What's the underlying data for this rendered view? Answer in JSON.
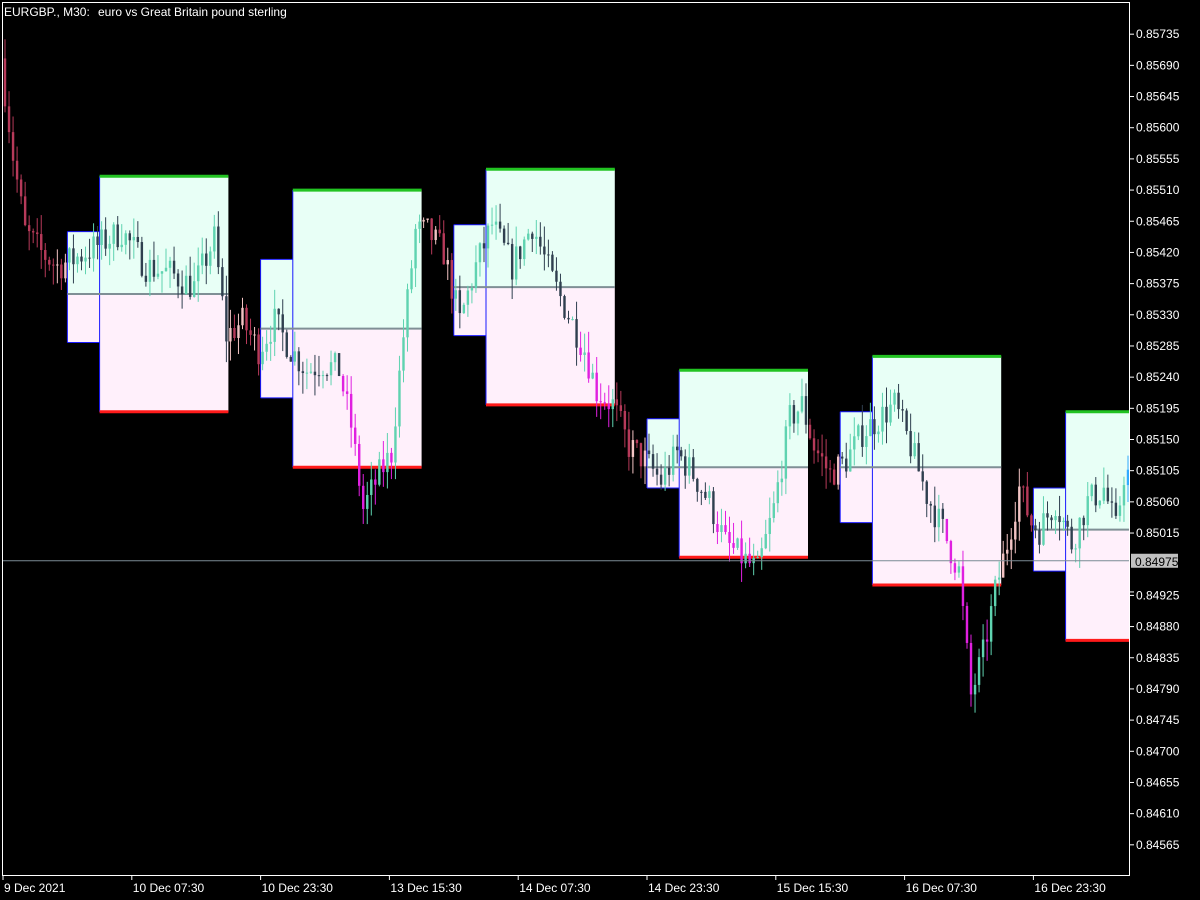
{
  "header": {
    "symbol": "EURGBP., M30:",
    "description": "euro vs Great Britain pound sterling"
  },
  "current_price": {
    "value": 0.84975,
    "label": "0.84975"
  },
  "colors": {
    "background": "#000000",
    "frame": "#ffffff",
    "upper_fill": "#e8fff6",
    "lower_fill": "#fff0fb",
    "high_line": "#22c322",
    "low_line": "#ff1a1a",
    "mid_line": "#7f8f95",
    "edge_line": "#1a1aff",
    "candle_bull_inside": "#5fd3b0",
    "candle_bear_inside": "#2f3f4f",
    "candle_bull_outside": "#f3c4c4",
    "candle_bear_outside": "#b73a5a",
    "candle_bear_strong": "#e020e0",
    "candle_last": "#33aaff",
    "current_price_line": "#7a8a94",
    "price_tag_bg": "#c0c0c0"
  },
  "chart_data": {
    "type": "candlestick",
    "title": "EURGBP., M30: euro vs Great Britain pound sterling",
    "ylim": [
      0.8452,
      0.8578
    ],
    "ytick_values": [
      0.85735,
      0.8569,
      0.85645,
      0.856,
      0.85555,
      0.8551,
      0.85465,
      0.8542,
      0.85375,
      0.8533,
      0.85285,
      0.8524,
      0.85195,
      0.8515,
      0.85105,
      0.8506,
      0.85015,
      0.8493,
      0.84925,
      0.8488,
      0.84835,
      0.8479,
      0.84745,
      0.847,
      0.84655,
      0.8461,
      0.84565
    ],
    "ytick_labels": [
      "0.85735",
      "0.85690",
      "0.85645",
      "0.85600",
      "0.85555",
      "0.85510",
      "0.85465",
      "0.85420",
      "0.85375",
      "0.85330",
      "0.85285",
      "0.85240",
      "0.85195",
      "0.85150",
      "0.85105",
      "0.85060",
      "0.85015",
      "",
      "0.84925",
      "0.84880",
      "0.84835",
      "0.84790",
      "0.84745",
      "0.84700",
      "0.84655",
      "0.84610",
      "0.84565"
    ],
    "xtick_labels": [
      "9 Dec 2021",
      "10 Dec 07:30",
      "10 Dec 23:30",
      "13 Dec 15:30",
      "14 Dec 07:30",
      "14 Dec 23:30",
      "15 Dec 15:30",
      "16 Dec 07:30",
      "16 Dec 23:30"
    ],
    "bar_count": 280,
    "xtick_bars": [
      0,
      32,
      64,
      96,
      128,
      160,
      192,
      224,
      256
    ],
    "grid": false,
    "sessions": [
      {
        "start_bar": 16,
        "end_bar": 56,
        "high": 0.8553,
        "low": 0.8519,
        "mid": 0.8536,
        "steps": [
          {
            "at_bar": 16,
            "top": 0.8545,
            "bottom": 0.8529
          },
          {
            "at_bar": 24,
            "top": 0.8553,
            "bottom": 0.8519
          }
        ]
      },
      {
        "start_bar": 64,
        "end_bar": 104,
        "high": 0.8551,
        "low": 0.8511,
        "mid": 0.8531,
        "steps": [
          {
            "at_bar": 64,
            "top": 0.8541,
            "bottom": 0.8521
          },
          {
            "at_bar": 72,
            "top": 0.8551,
            "bottom": 0.8511
          }
        ]
      },
      {
        "start_bar": 112,
        "end_bar": 152,
        "high": 0.8554,
        "low": 0.852,
        "mid": 0.8537,
        "steps": [
          {
            "at_bar": 112,
            "top": 0.8546,
            "bottom": 0.853
          },
          {
            "at_bar": 120,
            "top": 0.8554,
            "bottom": 0.852
          }
        ]
      },
      {
        "start_bar": 160,
        "end_bar": 200,
        "high": 0.8525,
        "low": 0.8498,
        "mid": 0.8511,
        "steps": [
          {
            "at_bar": 160,
            "top": 0.8518,
            "bottom": 0.8508
          },
          {
            "at_bar": 168,
            "top": 0.8525,
            "bottom": 0.8498
          }
        ]
      },
      {
        "start_bar": 208,
        "end_bar": 248,
        "high": 0.8527,
        "low": 0.8494,
        "mid": 0.8511,
        "steps": [
          {
            "at_bar": 208,
            "top": 0.8519,
            "bottom": 0.8503
          },
          {
            "at_bar": 216,
            "top": 0.8527,
            "bottom": 0.8494
          }
        ]
      },
      {
        "start_bar": 256,
        "end_bar": 280,
        "high": 0.8519,
        "low": 0.8486,
        "mid": 0.8502,
        "steps": [
          {
            "at_bar": 256,
            "top": 0.8508,
            "bottom": 0.8496
          },
          {
            "at_bar": 264,
            "top": 0.8519,
            "bottom": 0.8486
          }
        ]
      }
    ],
    "price_path": [
      [
        0,
        0.857
      ],
      [
        3,
        0.8556
      ],
      [
        6,
        0.8545
      ],
      [
        10,
        0.8542
      ],
      [
        14,
        0.854
      ],
      [
        18,
        0.8541
      ],
      [
        24,
        0.8543
      ],
      [
        30,
        0.8545
      ],
      [
        36,
        0.854
      ],
      [
        42,
        0.8539
      ],
      [
        48,
        0.8537
      ],
      [
        53,
        0.8544
      ],
      [
        56,
        0.853
      ],
      [
        60,
        0.8532
      ],
      [
        64,
        0.8528
      ],
      [
        68,
        0.8532
      ],
      [
        72,
        0.8528
      ],
      [
        76,
        0.8525
      ],
      [
        80,
        0.8526
      ],
      [
        84,
        0.8525
      ],
      [
        87,
        0.8517
      ],
      [
        90,
        0.8505
      ],
      [
        94,
        0.851
      ],
      [
        97,
        0.8513
      ],
      [
        100,
        0.853
      ],
      [
        103,
        0.8545
      ],
      [
        106,
        0.8545
      ],
      [
        110,
        0.8542
      ],
      [
        114,
        0.8532
      ],
      [
        118,
        0.854
      ],
      [
        122,
        0.8546
      ],
      [
        127,
        0.854
      ],
      [
        132,
        0.8546
      ],
      [
        137,
        0.8538
      ],
      [
        141,
        0.8533
      ],
      [
        145,
        0.8528
      ],
      [
        148,
        0.8522
      ],
      [
        152,
        0.852
      ],
      [
        156,
        0.8514
      ],
      [
        160,
        0.8512
      ],
      [
        164,
        0.8509
      ],
      [
        168,
        0.8513
      ],
      [
        172,
        0.851
      ],
      [
        176,
        0.8506
      ],
      [
        180,
        0.85
      ],
      [
        184,
        0.8498
      ],
      [
        188,
        0.8496
      ],
      [
        192,
        0.8505
      ],
      [
        196,
        0.8518
      ],
      [
        199,
        0.852
      ],
      [
        202,
        0.8514
      ],
      [
        206,
        0.851
      ],
      [
        210,
        0.8512
      ],
      [
        214,
        0.8516
      ],
      [
        218,
        0.8518
      ],
      [
        222,
        0.852
      ],
      [
        226,
        0.8514
      ],
      [
        230,
        0.8507
      ],
      [
        234,
        0.8502
      ],
      [
        238,
        0.8496
      ],
      [
        241,
        0.8478
      ],
      [
        244,
        0.8484
      ],
      [
        247,
        0.8493
      ],
      [
        250,
        0.85
      ],
      [
        253,
        0.8508
      ],
      [
        256,
        0.8503
      ],
      [
        258,
        0.8502
      ],
      [
        262,
        0.8506
      ],
      [
        266,
        0.85
      ],
      [
        270,
        0.8506
      ],
      [
        274,
        0.8508
      ],
      [
        277,
        0.8502
      ],
      [
        279,
        0.851
      ]
    ]
  }
}
